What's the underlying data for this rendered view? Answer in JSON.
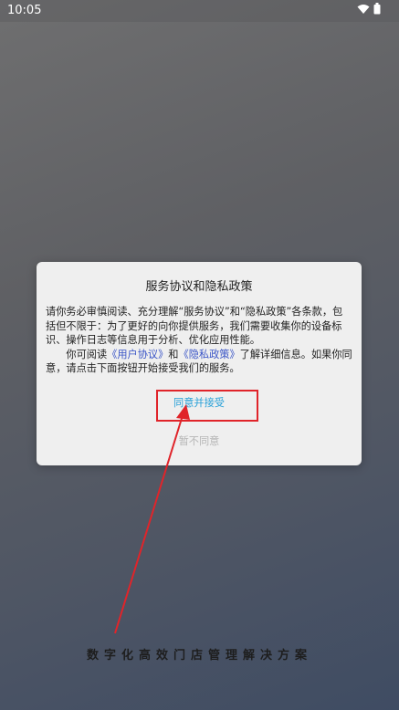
{
  "status_bar": {
    "time": "10:05",
    "icons": [
      "wifi-icon",
      "battery-icon"
    ]
  },
  "dialog": {
    "title": "服务协议和隐私政策",
    "paragraph1": "请你务必审慎阅读、充分理解“服务协议”和“隐私政策”各条款，包括但不限于：为了更好的向你提供服务，我们需要收集你的设备标识、操作日志等信息用于分析、优化应用性能。",
    "paragraph2_prefix": "你可阅读",
    "user_agreement_link": "《用户协议》",
    "paragraph2_and": "和",
    "privacy_policy_link": "《隐私政策》",
    "paragraph2_suffix": "了解详细信息。如果你同意，请点击下面按钮开始接受我们的服务。",
    "agree_label": "同意并接受",
    "disagree_label": "暂不同意"
  },
  "annotation": {
    "color": "#e0242a"
  },
  "slogan": "数字化高效门店管理解决方案",
  "colors": {
    "link": "#3a55c7",
    "agree": "#27a0d8",
    "disagree": "#b6b6b6"
  }
}
